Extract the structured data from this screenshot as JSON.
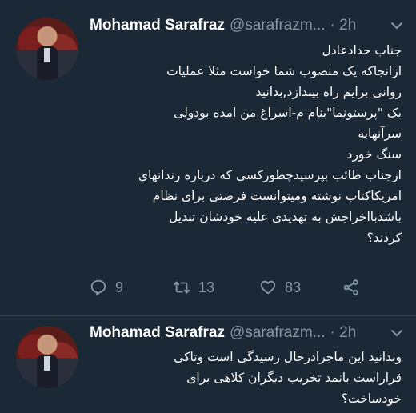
{
  "tweets": [
    {
      "author": {
        "name": "Mohamad Sarafraz",
        "handle": "@sarafrazm...",
        "time": "· 2h"
      },
      "lines": [
        "جناب حدادعادل",
        "ازانجاکه یک منصوب شما خواست مثلا عملیات",
        "روانی برایم راه بیندازد,بدانید",
        "یک \"پرستونما\"بنام م-اسراغ من امده بودولی",
        "سرآنهابه",
        "سنگ خورد",
        "ازجناب طائب بپرسیدچطورکسی که درباره زندانهای",
        "امریکاکتاب نوشته ومیتوانست فرصتی برای نظام",
        "باشدبااخراجش به تهدیدی علیه خودشان تبدیل",
        "کردند؟"
      ],
      "actions": {
        "replies": "9",
        "retweets": "13",
        "likes": "83"
      }
    },
    {
      "author": {
        "name": "Mohamad Sarafraz",
        "handle": "@sarafrazm...",
        "time": "· 2h"
      },
      "lines": [
        "وبدانید این ماجرادرحال رسیدگی است وتاکی",
        "قراراست بانمد تخریب دیگران کلاهی برای",
        "خودساخت؟"
      ]
    }
  ],
  "colors": {
    "background": "#1b2836",
    "secondary_text": "#8899a6",
    "divider": "#38444d"
  },
  "icons": [
    "reply-icon",
    "retweet-icon",
    "like-icon",
    "share-icon",
    "chevron-down-icon"
  ]
}
